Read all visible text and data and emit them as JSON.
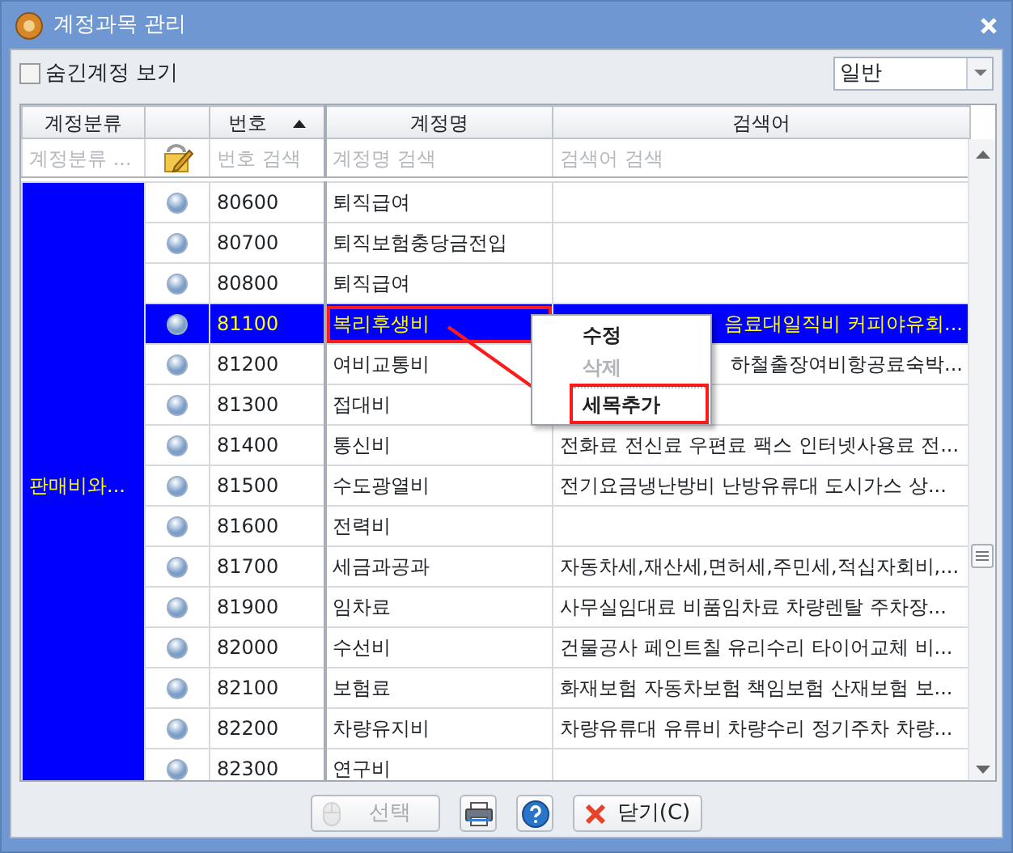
{
  "window": {
    "title": "계정과목 관리"
  },
  "show_hidden": {
    "label": "숨긴계정 보기",
    "checked": false
  },
  "view_select": {
    "value": "일반"
  },
  "table": {
    "columns": [
      {
        "label": "계정분류",
        "sorted": false
      },
      {
        "label": "번호",
        "sorted": true
      },
      {
        "label": "계정명",
        "sorted": false
      },
      {
        "label": "검색어",
        "sorted": false
      }
    ],
    "filters": [
      {
        "placeholder": "계정분류 ..."
      },
      {
        "placeholder": "번호 검색"
      },
      {
        "placeholder": "계정명 검색"
      },
      {
        "placeholder": "검색어 검색"
      }
    ],
    "category": "판매비와...",
    "rows": [
      {
        "number": "80600",
        "name": "퇴직급여",
        "selected": false
      },
      {
        "number": "80700",
        "name": "퇴직보험충당금전입",
        "selected": false
      },
      {
        "number": "80800",
        "name": "퇴직급여",
        "selected": false
      },
      {
        "number": "81100",
        "name": "복리후생비",
        "keywords": "음료대일직비 커피야유회...",
        "keywords_cut_start": true,
        "name_highlighted": true,
        "selected": true
      },
      {
        "number": "81200",
        "name": "여비교통비",
        "keywords": "하철출장여비항공료숙박...",
        "keywords_cut_start": true,
        "selected": false
      },
      {
        "number": "81300",
        "name": "접대비",
        "selected": false
      },
      {
        "number": "81400",
        "name": "통신비",
        "keywords": "전화료 전신료 우편료 팩스 인터넷사용료 전...",
        "selected": false
      },
      {
        "number": "81500",
        "name": "수도광열비",
        "keywords": "전기요금냉난방비 난방유류대 도시가스 상...",
        "selected": false
      },
      {
        "number": "81600",
        "name": "전력비",
        "selected": false
      },
      {
        "number": "81700",
        "name": "세금과공과",
        "keywords": "자동차세,재산세,면허세,주민세,적십자회비,...",
        "selected": false
      },
      {
        "number": "81900",
        "name": "임차료",
        "keywords": "사무실임대료 비품임차료 차량렌탈 주차장...",
        "selected": false
      },
      {
        "number": "82000",
        "name": "수선비",
        "keywords": "건물공사 페인트칠 유리수리 타이어교체 비...",
        "selected": false
      },
      {
        "number": "82100",
        "name": "보험료",
        "keywords": "화재보험 자동차보험 책임보험 산재보험 보...",
        "selected": false
      },
      {
        "number": "82200",
        "name": "차량유지비",
        "keywords": "차량유류대 유류비 차량수리 정기주차 차량...",
        "selected": false
      },
      {
        "number": "82300",
        "name": "연구비",
        "selected": false
      }
    ]
  },
  "context_menu": {
    "items": [
      {
        "label": "수정",
        "disabled": false,
        "separator_before": false,
        "highlighted": false
      },
      {
        "label": "삭제",
        "disabled": true,
        "separator_before": false,
        "highlighted": false
      },
      {
        "label": "세목추가",
        "disabled": false,
        "separator_before": true,
        "highlighted": true
      }
    ]
  },
  "buttons": [
    {
      "kind": "select",
      "label": "선택",
      "disabled": true
    },
    {
      "kind": "print",
      "disabled": false
    },
    {
      "kind": "help",
      "disabled": false
    },
    {
      "kind": "close",
      "label": "닫기(C)",
      "disabled": false
    }
  ]
}
